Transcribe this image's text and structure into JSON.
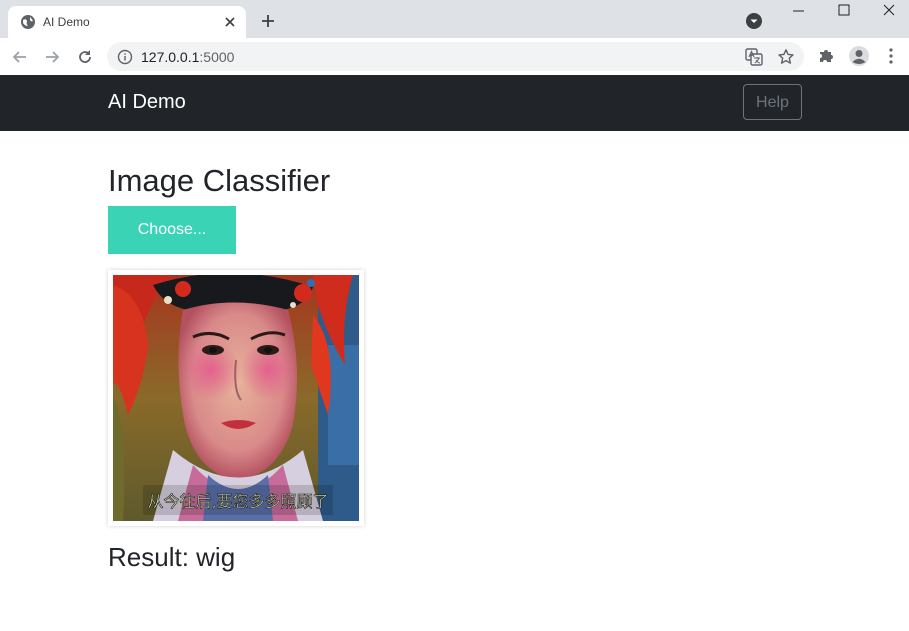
{
  "browser": {
    "tab_title": "AI Demo",
    "url_host": "127.0.0.1",
    "url_port": ":5000",
    "icons": {
      "favicon": "globe-icon",
      "close_tab": "close-icon",
      "new_tab": "plus-icon",
      "back": "arrow-left-icon",
      "forward": "arrow-right-icon",
      "reload": "reload-icon",
      "site_info": "info-icon",
      "translate": "translate-icon",
      "bookmark": "star-icon",
      "extensions": "puzzle-icon",
      "profile": "profile-icon",
      "menu": "kebab-menu-icon"
    }
  },
  "navbar": {
    "brand": "AI Demo",
    "help_label": "Help"
  },
  "main": {
    "title": "Image Classifier",
    "choose_label": "Choose...",
    "subtitle_caption": "从今往后,要您多多照顾了",
    "result_text": "Result: wig"
  },
  "colors": {
    "navbar_bg": "#212529",
    "choose_button_bg": "#3ad3b6",
    "help_border": "#6c757d"
  }
}
